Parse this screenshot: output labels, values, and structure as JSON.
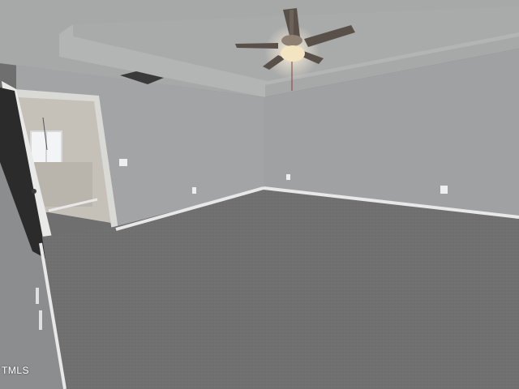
{
  "watermark": {
    "text": "TMLS"
  },
  "colors": {
    "ceiling": "#a7a8a8",
    "tray": "#bdbebe",
    "wall_left": "#a3a4a5",
    "wall_right": "#a0a1a2",
    "wall_near_left": "#8c8d8e",
    "carpet": "#707070",
    "baseboard": "#e8e8e8",
    "door": "#e9e9e7",
    "hall_wall": "#c6c1b8",
    "fan_blade": "#5a504a",
    "light_glow": "#f3e4c2"
  }
}
